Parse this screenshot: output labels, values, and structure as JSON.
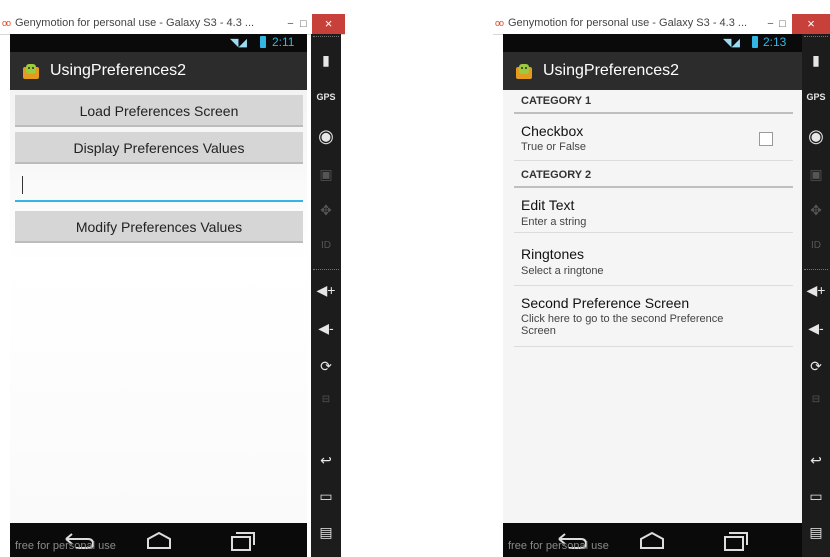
{
  "left_window": {
    "title": "Genymotion for personal use - Galaxy S3 - 4.3 ...",
    "status_time": "2:11",
    "app_title": "UsingPreferences2",
    "buttons": [
      "Load Preferences Screen",
      "Display Preferences Values",
      "Modify Preferences Values"
    ],
    "edit_value": "",
    "watermark": "free for personal use"
  },
  "right_window": {
    "title": "Genymotion for personal use - Galaxy S3 - 4.3 ...",
    "status_time": "2:13",
    "app_title": "UsingPreferences2",
    "category1": "CATEGORY 1",
    "checkbox_title": "Checkbox",
    "checkbox_summary": "True or False",
    "checkbox_checked": false,
    "category2": "CATEGORY 2",
    "edit_text_title": "Edit Text",
    "edit_text_summary": "Enter a string",
    "ringtones_title": "Ringtones",
    "ringtones_summary": "Select a ringtone",
    "second_screen_title": "Second Preference Screen",
    "second_screen_summary": "Click here to go to the second Preference Screen",
    "watermark": "free for personal use"
  },
  "window_controls": {
    "minimize": "−",
    "maximize": "□",
    "close": "×"
  },
  "sidebar_labels": {
    "gps": "GPS",
    "id": "ID"
  },
  "colors": {
    "accent": "#33b5e5",
    "action_bar": "#2c2c2c",
    "close_button": "#c7413a",
    "sidebar": "#1c1c1c"
  }
}
